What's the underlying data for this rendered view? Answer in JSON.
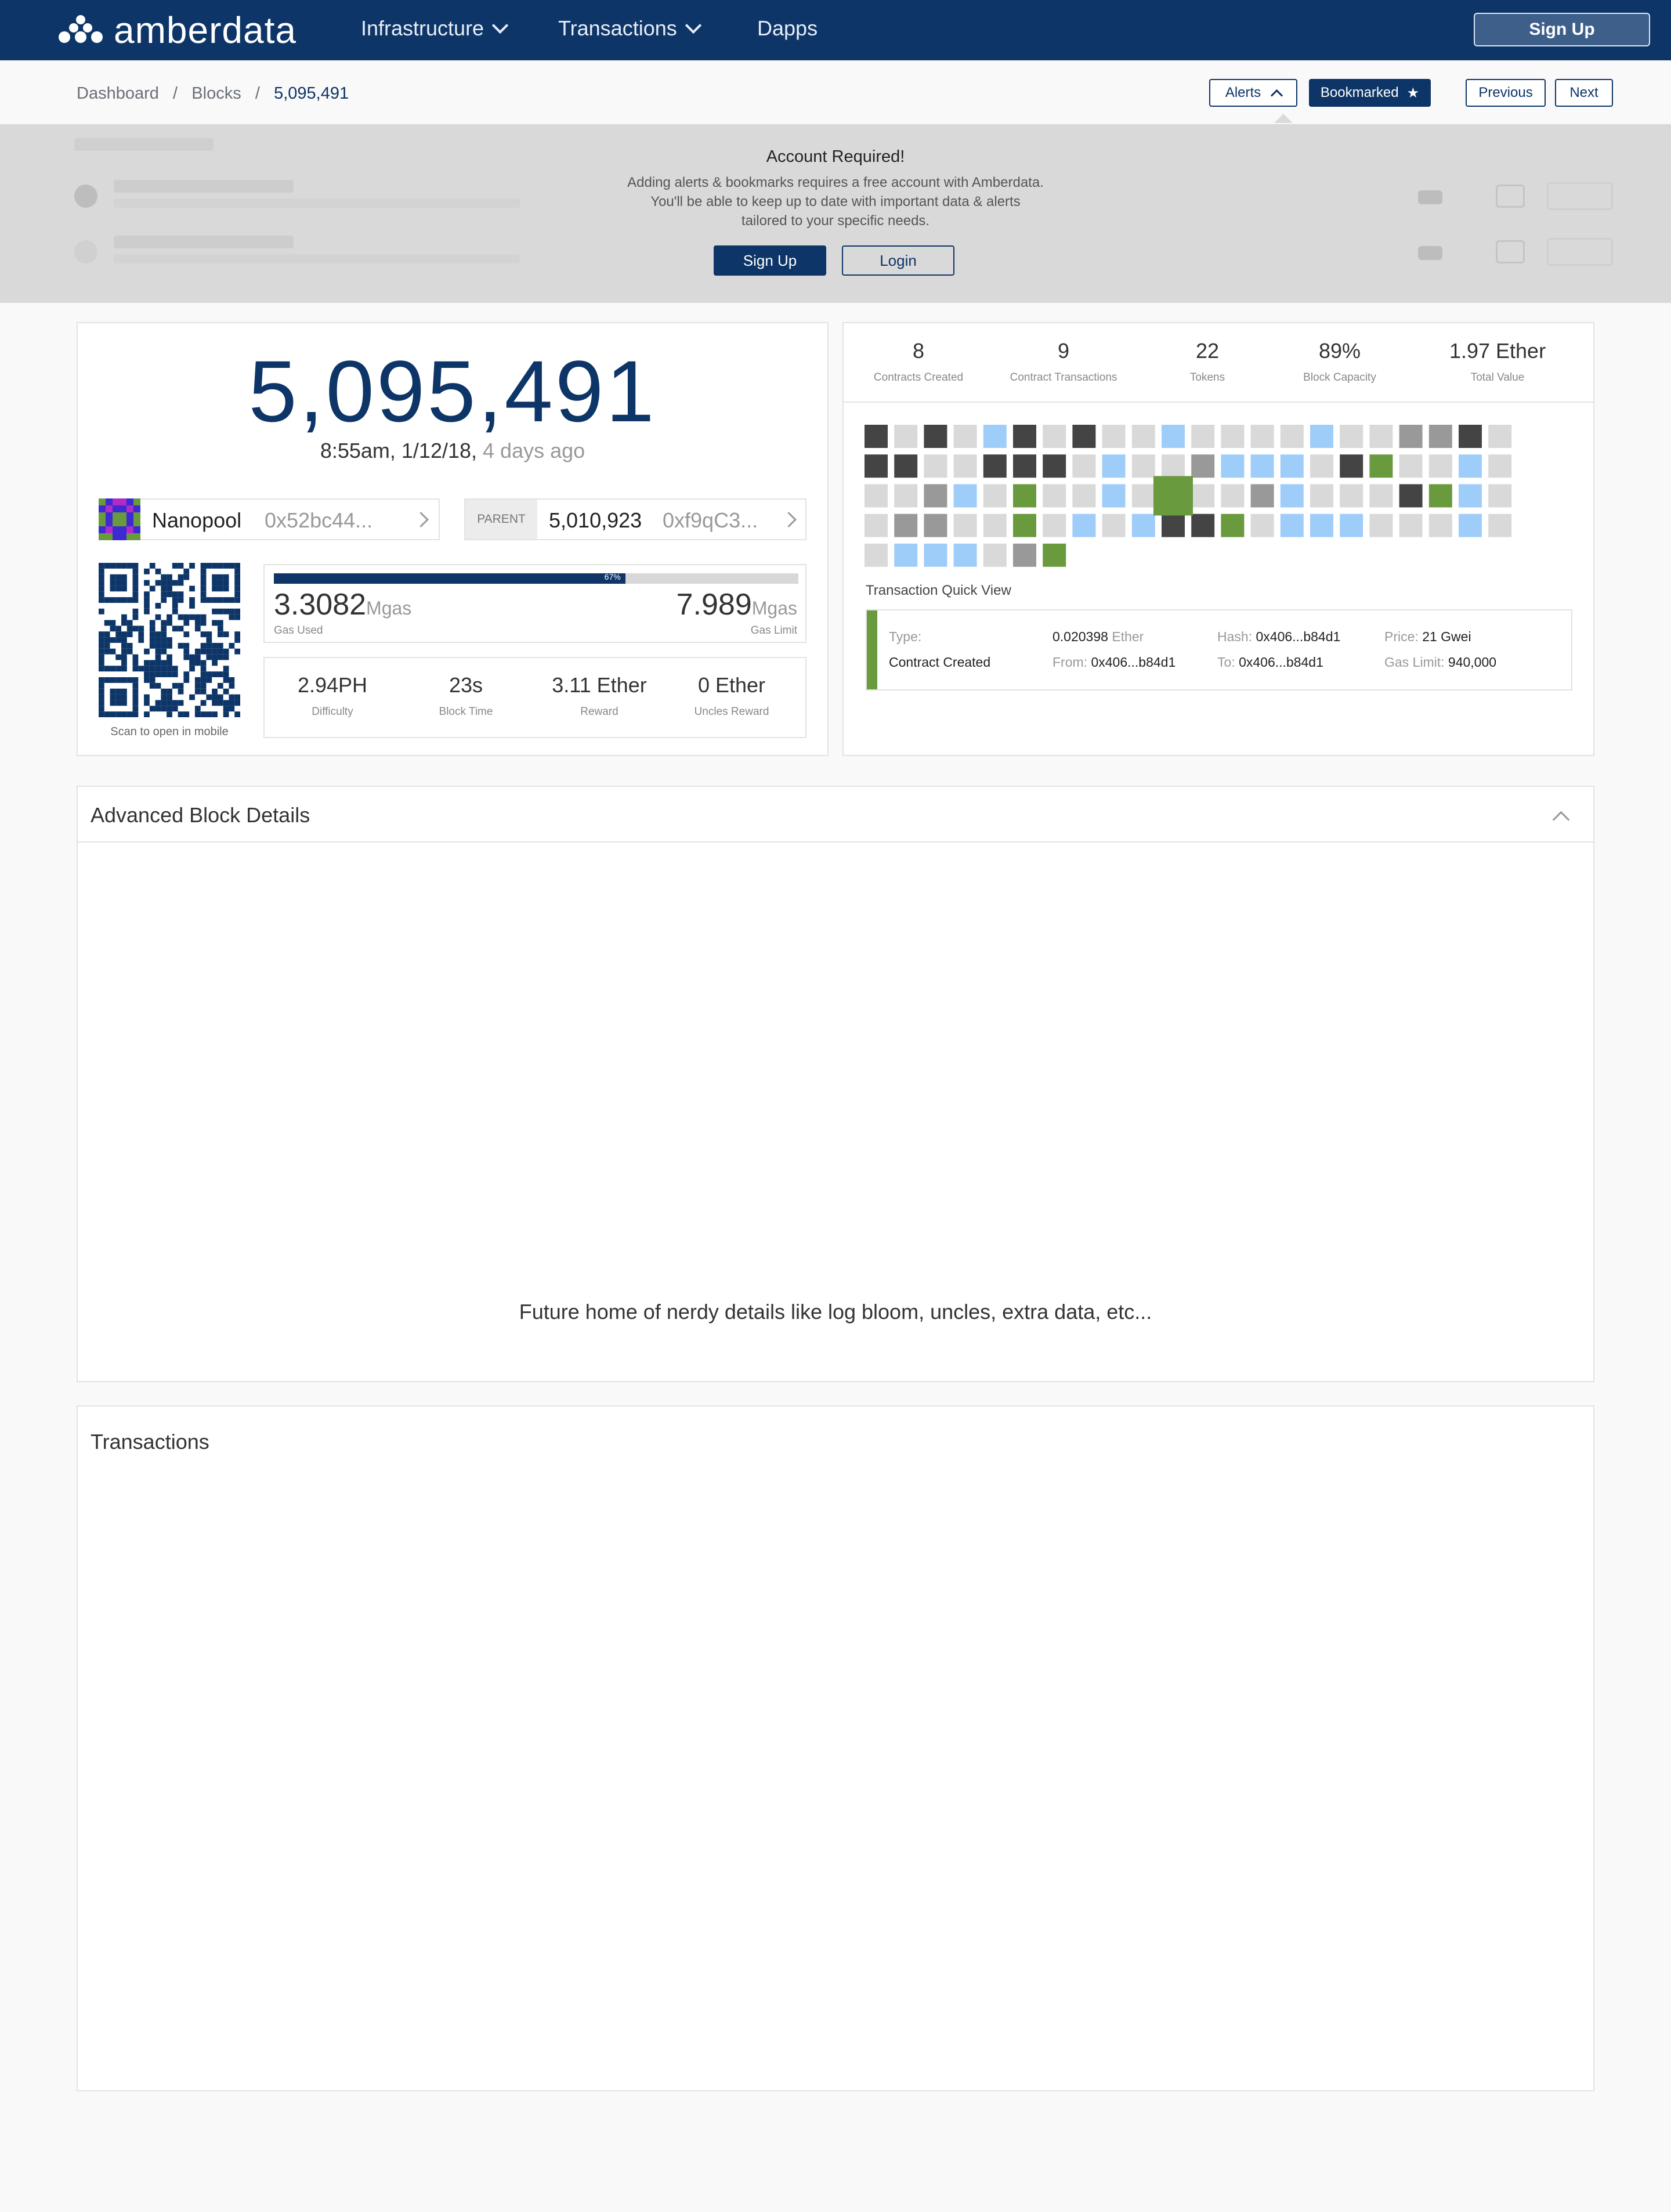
{
  "brand": {
    "name": "amberdata",
    "nav_color": "#0d3567"
  },
  "nav": [
    {
      "label": "Infrastructure",
      "dropdown": true
    },
    {
      "label": "Transactions",
      "dropdown": true
    },
    {
      "label": "Dapps",
      "dropdown": false
    }
  ],
  "header": {
    "signup_label": "Sign Up"
  },
  "breadcrumb": {
    "items": [
      "Dashboard",
      "Blocks",
      "5,095,491"
    ],
    "separator": "/"
  },
  "toolbar": {
    "alerts_label": "Alerts",
    "bookmarked_label": "Bookmarked",
    "bookmarked_icon": "★",
    "previous_label": "Previous",
    "next_label": "Next"
  },
  "account_prompt": {
    "title": "Account Required!",
    "lines": [
      "Adding alerts & bookmarks requires a free account with Amberdata.",
      "You'll be able to keep up to date with important data & alerts",
      "tailored to your specific needs."
    ],
    "signup_label": "Sign Up",
    "login_label": "Login"
  },
  "block": {
    "number": "5,095,491",
    "time": "8:55am, 1/12/18,",
    "ago": "4 days ago",
    "miner": {
      "name": "Nanopool",
      "hash": "0x52bc44..."
    },
    "parent": {
      "tag": "PARENT",
      "number": "5,010,923",
      "hash": "0xf9qC3..."
    },
    "qr_caption": "Scan to open in mobile",
    "gas": {
      "percent": 0.67,
      "percent_label": "67%",
      "used": "3.3082",
      "used_unit": "Mgas",
      "used_label": "Gas Used",
      "limit": "7.989",
      "limit_unit": "Mgas",
      "limit_label": "Gas Limit"
    },
    "metrics": [
      {
        "value": "2.94PH",
        "label": "Difficulty"
      },
      {
        "value": "23s",
        "label": "Block Time"
      },
      {
        "value": "3.11 Ether",
        "label": "Reward"
      },
      {
        "value": "0 Ether",
        "label": "Uncles Reward"
      }
    ]
  },
  "stats": [
    {
      "value": "8",
      "label": "Contracts Created"
    },
    {
      "value": "9",
      "label": "Contract Transactions"
    },
    {
      "value": "22",
      "label": "Tokens"
    },
    {
      "value": "89%",
      "label": "Block Capacity"
    },
    {
      "value": "1.97 Ether",
      "label": "Total Value"
    }
  ],
  "tx_grid": {
    "colors": {
      "d": "#444444",
      "l": "#d9d9d9",
      "m": "#999999",
      "b": "#9fcdf9",
      "g": "#6a9a3e"
    },
    "rows": [
      "dldlbdldllbllllbllmmdl",
      "ddlldddlbllmbbbldgllbl",
      "llmblgllbllllmbllldgbl",
      "lmmllglblbddglbbblllbl",
      "lbbblmg"
    ],
    "selected": {
      "row": 2,
      "col": 10
    }
  },
  "quick_view": {
    "title": "Transaction Quick View",
    "type_key": "Type:",
    "type_value": "Contract Created",
    "value": "0.020398",
    "value_unit": "Ether",
    "from_key": "From:",
    "from_value": "0x406...b84d1",
    "hash_key": "Hash:",
    "hash_value": "0x406...b84d1",
    "to_key": "To:",
    "to_value": "0x406...b84d1",
    "price_key": "Price:",
    "price_value": "21 Gwei",
    "gas_limit_key": "Gas Limit:",
    "gas_limit_value": "940,000",
    "accent": "#6a9a3e"
  },
  "advanced": {
    "title": "Advanced Block Details",
    "placeholder": "Future home of nerdy details like log bloom, uncles, extra data, etc..."
  },
  "transactions": {
    "title": "Transactions"
  }
}
